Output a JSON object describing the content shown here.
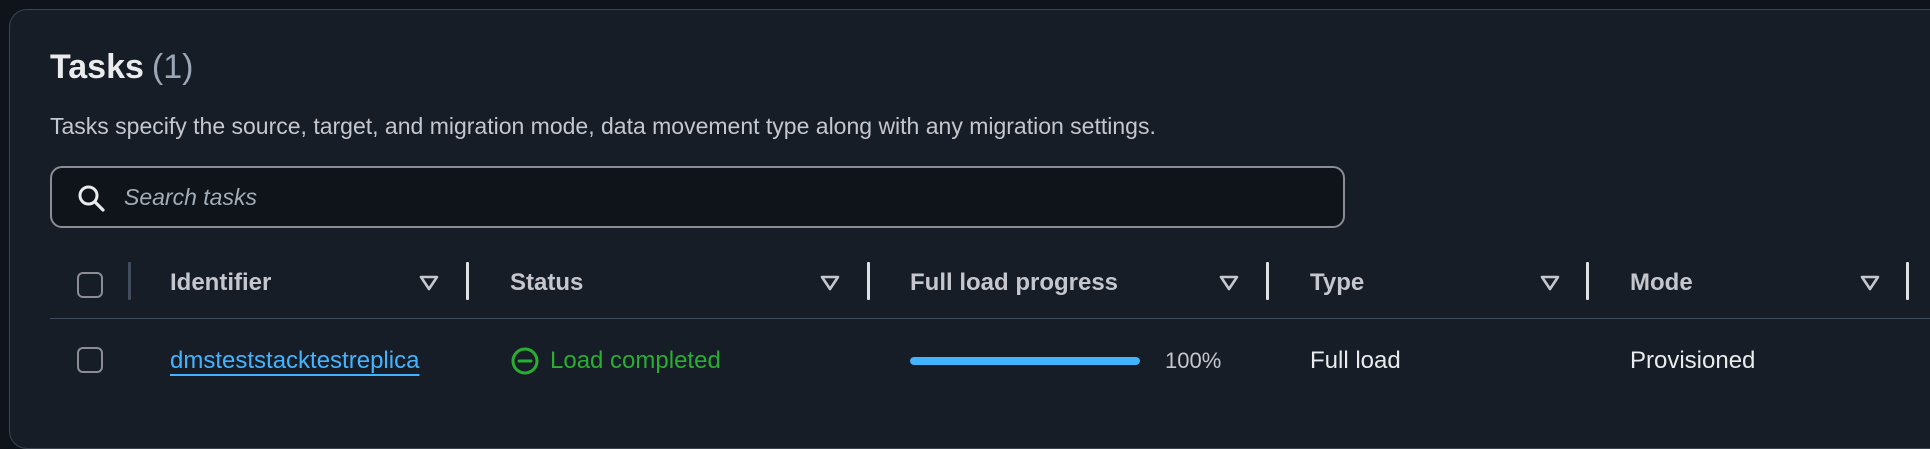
{
  "header": {
    "title": "Tasks",
    "count": "(1)",
    "description": "Tasks specify the source, target, and migration mode, data movement type along with any migration settings."
  },
  "search": {
    "placeholder": "Search tasks",
    "value": ""
  },
  "table": {
    "columns": [
      {
        "label": "Identifier"
      },
      {
        "label": "Status"
      },
      {
        "label": "Full load progress"
      },
      {
        "label": "Type"
      },
      {
        "label": "Mode"
      }
    ],
    "rows": [
      {
        "identifier": "dmsteststacktestreplica",
        "status": "Load completed",
        "progress_percent": 100,
        "progress_label": "100%",
        "type": "Full load",
        "mode": "Provisioned"
      }
    ]
  },
  "colors": {
    "background": "#0f141a",
    "panel": "#161d26",
    "link": "#42b4ff",
    "success": "#29ad32",
    "progress": "#42b4ff"
  },
  "icons": {
    "search": "search-icon",
    "sort": "caret-down-icon",
    "status": "status-completed-icon"
  }
}
